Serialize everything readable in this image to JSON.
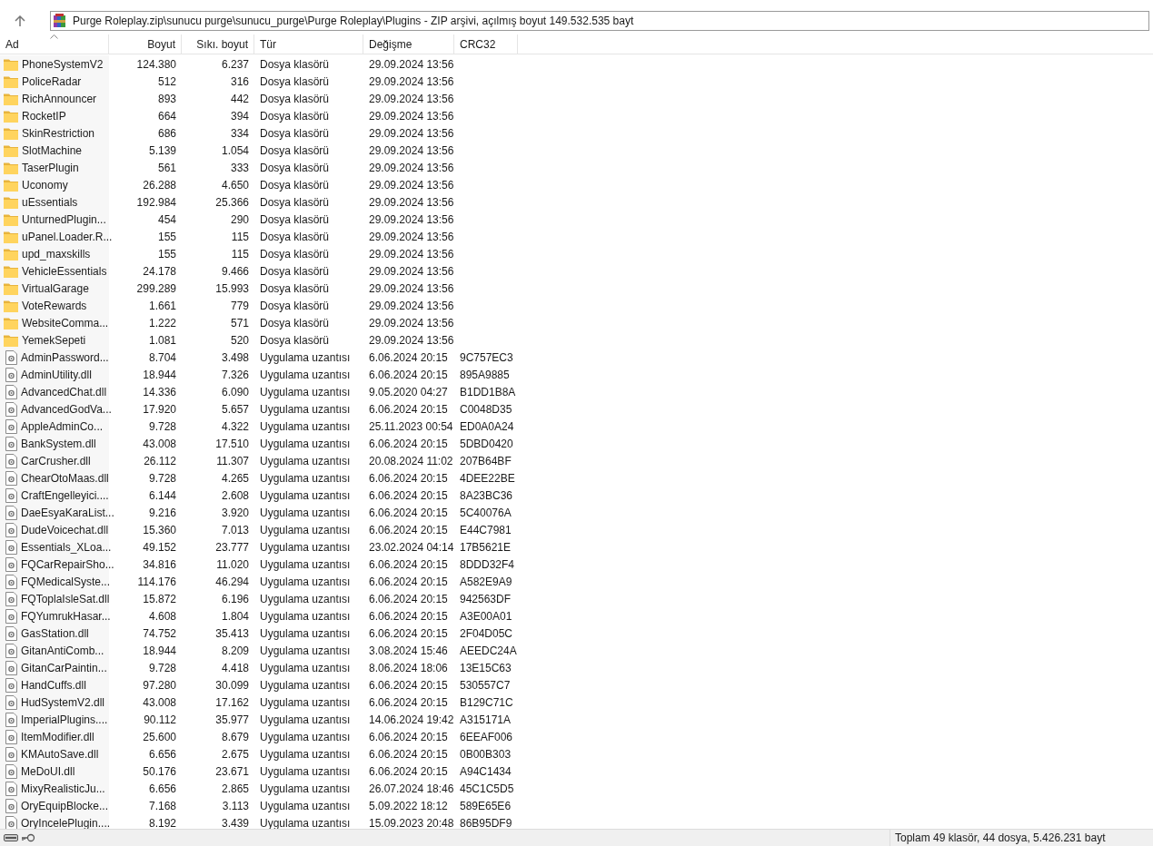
{
  "address": {
    "path": "Purge Roleplay.zip\\sunucu purge\\sunucu_purge\\Purge Roleplay\\Plugins - ZIP arşivi, açılmış boyut 149.532.535 bayt"
  },
  "columns": [
    {
      "label": "Ad",
      "sorted": true
    },
    {
      "label": "Boyut",
      "sorted": false
    },
    {
      "label": "Sıkı. boyut",
      "sorted": false
    },
    {
      "label": "Tür",
      "sorted": false
    },
    {
      "label": "Değişme",
      "sorted": false
    },
    {
      "label": "CRC32",
      "sorted": false
    }
  ],
  "rows": [
    {
      "kind": "folder",
      "name": "PhoneSystemV2",
      "size": "124.380",
      "packed": "6.237",
      "type": "Dosya klasörü",
      "modified": "29.09.2024 13:56"
    },
    {
      "kind": "folder",
      "name": "PoliceRadar",
      "size": "512",
      "packed": "316",
      "type": "Dosya klasörü",
      "modified": "29.09.2024 13:56"
    },
    {
      "kind": "folder",
      "name": "RichAnnouncer",
      "size": "893",
      "packed": "442",
      "type": "Dosya klasörü",
      "modified": "29.09.2024 13:56"
    },
    {
      "kind": "folder",
      "name": "RocketIP",
      "size": "664",
      "packed": "394",
      "type": "Dosya klasörü",
      "modified": "29.09.2024 13:56"
    },
    {
      "kind": "folder",
      "name": "SkinRestriction",
      "size": "686",
      "packed": "334",
      "type": "Dosya klasörü",
      "modified": "29.09.2024 13:56"
    },
    {
      "kind": "folder",
      "name": "SlotMachine",
      "size": "5.139",
      "packed": "1.054",
      "type": "Dosya klasörü",
      "modified": "29.09.2024 13:56"
    },
    {
      "kind": "folder",
      "name": "TaserPlugin",
      "size": "561",
      "packed": "333",
      "type": "Dosya klasörü",
      "modified": "29.09.2024 13:56"
    },
    {
      "kind": "folder",
      "name": "Uconomy",
      "size": "26.288",
      "packed": "4.650",
      "type": "Dosya klasörü",
      "modified": "29.09.2024 13:56"
    },
    {
      "kind": "folder",
      "name": "uEssentials",
      "size": "192.984",
      "packed": "25.366",
      "type": "Dosya klasörü",
      "modified": "29.09.2024 13:56"
    },
    {
      "kind": "folder",
      "name": "UnturnedPlugin...",
      "size": "454",
      "packed": "290",
      "type": "Dosya klasörü",
      "modified": "29.09.2024 13:56"
    },
    {
      "kind": "folder",
      "name": "uPanel.Loader.R...",
      "size": "155",
      "packed": "115",
      "type": "Dosya klasörü",
      "modified": "29.09.2024 13:56"
    },
    {
      "kind": "folder",
      "name": "upd_maxskills",
      "size": "155",
      "packed": "115",
      "type": "Dosya klasörü",
      "modified": "29.09.2024 13:56"
    },
    {
      "kind": "folder",
      "name": "VehicleEssentials",
      "size": "24.178",
      "packed": "9.466",
      "type": "Dosya klasörü",
      "modified": "29.09.2024 13:56"
    },
    {
      "kind": "folder",
      "name": "VirtualGarage",
      "size": "299.289",
      "packed": "15.993",
      "type": "Dosya klasörü",
      "modified": "29.09.2024 13:56"
    },
    {
      "kind": "folder",
      "name": "VoteRewards",
      "size": "1.661",
      "packed": "779",
      "type": "Dosya klasörü",
      "modified": "29.09.2024 13:56"
    },
    {
      "kind": "folder",
      "name": "WebsiteComma...",
      "size": "1.222",
      "packed": "571",
      "type": "Dosya klasörü",
      "modified": "29.09.2024 13:56"
    },
    {
      "kind": "folder",
      "name": "YemekSepeti",
      "size": "1.081",
      "packed": "520",
      "type": "Dosya klasörü",
      "modified": "29.09.2024 13:56"
    },
    {
      "kind": "file",
      "name": "AdminPassword...",
      "size": "8.704",
      "packed": "3.498",
      "type": "Uygulama uzantısı",
      "modified": "6.06.2024 20:15",
      "crc": "9C757EC3"
    },
    {
      "kind": "file",
      "name": "AdminUtility.dll",
      "size": "18.944",
      "packed": "7.326",
      "type": "Uygulama uzantısı",
      "modified": "6.06.2024 20:15",
      "crc": "895A9885"
    },
    {
      "kind": "file",
      "name": "AdvancedChat.dll",
      "size": "14.336",
      "packed": "6.090",
      "type": "Uygulama uzantısı",
      "modified": "9.05.2020 04:27",
      "crc": "B1DD1B8A"
    },
    {
      "kind": "file",
      "name": "AdvancedGodVa...",
      "size": "17.920",
      "packed": "5.657",
      "type": "Uygulama uzantısı",
      "modified": "6.06.2024 20:15",
      "crc": "C0048D35"
    },
    {
      "kind": "file",
      "name": "AppleAdminCo...",
      "size": "9.728",
      "packed": "4.322",
      "type": "Uygulama uzantısı",
      "modified": "25.11.2023 00:54",
      "crc": "ED0A0A24"
    },
    {
      "kind": "file",
      "name": "BankSystem.dll",
      "size": "43.008",
      "packed": "17.510",
      "type": "Uygulama uzantısı",
      "modified": "6.06.2024 20:15",
      "crc": "5DBD0420"
    },
    {
      "kind": "file",
      "name": "CarCrusher.dll",
      "size": "26.112",
      "packed": "11.307",
      "type": "Uygulama uzantısı",
      "modified": "20.08.2024 11:02",
      "crc": "207B64BF"
    },
    {
      "kind": "file",
      "name": "ChearOtoMaas.dll",
      "size": "9.728",
      "packed": "4.265",
      "type": "Uygulama uzantısı",
      "modified": "6.06.2024 20:15",
      "crc": "4DEE22BE"
    },
    {
      "kind": "file",
      "name": "CraftEngelleyici....",
      "size": "6.144",
      "packed": "2.608",
      "type": "Uygulama uzantısı",
      "modified": "6.06.2024 20:15",
      "crc": "8A23BC36"
    },
    {
      "kind": "file",
      "name": "DaeEsyaKaraList...",
      "size": "9.216",
      "packed": "3.920",
      "type": "Uygulama uzantısı",
      "modified": "6.06.2024 20:15",
      "crc": "5C40076A"
    },
    {
      "kind": "file",
      "name": "DudeVoicechat.dll",
      "size": "15.360",
      "packed": "7.013",
      "type": "Uygulama uzantısı",
      "modified": "6.06.2024 20:15",
      "crc": "E44C7981"
    },
    {
      "kind": "file",
      "name": "Essentials_XLoa...",
      "size": "49.152",
      "packed": "23.777",
      "type": "Uygulama uzantısı",
      "modified": "23.02.2024 04:14",
      "crc": "17B5621E"
    },
    {
      "kind": "file",
      "name": "FQCarRepairSho...",
      "size": "34.816",
      "packed": "11.020",
      "type": "Uygulama uzantısı",
      "modified": "6.06.2024 20:15",
      "crc": "8DDD32F4"
    },
    {
      "kind": "file",
      "name": "FQMedicalSyste...",
      "size": "114.176",
      "packed": "46.294",
      "type": "Uygulama uzantısı",
      "modified": "6.06.2024 20:15",
      "crc": "A582E9A9"
    },
    {
      "kind": "file",
      "name": "FQToplaIsleSat.dll",
      "size": "15.872",
      "packed": "6.196",
      "type": "Uygulama uzantısı",
      "modified": "6.06.2024 20:15",
      "crc": "942563DF"
    },
    {
      "kind": "file",
      "name": "FQYumrukHasar...",
      "size": "4.608",
      "packed": "1.804",
      "type": "Uygulama uzantısı",
      "modified": "6.06.2024 20:15",
      "crc": "A3E00A01"
    },
    {
      "kind": "file",
      "name": "GasStation.dll",
      "size": "74.752",
      "packed": "35.413",
      "type": "Uygulama uzantısı",
      "modified": "6.06.2024 20:15",
      "crc": "2F04D05C"
    },
    {
      "kind": "file",
      "name": "GitanAntiComb...",
      "size": "18.944",
      "packed": "8.209",
      "type": "Uygulama uzantısı",
      "modified": "3.08.2024 15:46",
      "crc": "AEEDC24A"
    },
    {
      "kind": "file",
      "name": "GitanCarPaintin...",
      "size": "9.728",
      "packed": "4.418",
      "type": "Uygulama uzantısı",
      "modified": "8.06.2024 18:06",
      "crc": "13E15C63"
    },
    {
      "kind": "file",
      "name": "HandCuffs.dll",
      "size": "97.280",
      "packed": "30.099",
      "type": "Uygulama uzantısı",
      "modified": "6.06.2024 20:15",
      "crc": "530557C7"
    },
    {
      "kind": "file",
      "name": "HudSystemV2.dll",
      "size": "43.008",
      "packed": "17.162",
      "type": "Uygulama uzantısı",
      "modified": "6.06.2024 20:15",
      "crc": "B129C71C"
    },
    {
      "kind": "file",
      "name": "ImperialPlugins....",
      "size": "90.112",
      "packed": "35.977",
      "type": "Uygulama uzantısı",
      "modified": "14.06.2024 19:42",
      "crc": "A315171A"
    },
    {
      "kind": "file",
      "name": "ItemModifier.dll",
      "size": "25.600",
      "packed": "8.679",
      "type": "Uygulama uzantısı",
      "modified": "6.06.2024 20:15",
      "crc": "6EEAF006"
    },
    {
      "kind": "file",
      "name": "KMAutoSave.dll",
      "size": "6.656",
      "packed": "2.675",
      "type": "Uygulama uzantısı",
      "modified": "6.06.2024 20:15",
      "crc": "0B00B303"
    },
    {
      "kind": "file",
      "name": "MeDoUI.dll",
      "size": "50.176",
      "packed": "23.671",
      "type": "Uygulama uzantısı",
      "modified": "6.06.2024 20:15",
      "crc": "A94C1434"
    },
    {
      "kind": "file",
      "name": "MixyRealisticJu...",
      "size": "6.656",
      "packed": "2.865",
      "type": "Uygulama uzantısı",
      "modified": "26.07.2024 18:46",
      "crc": "45C1C5D5"
    },
    {
      "kind": "file",
      "name": "OryEquipBlocke...",
      "size": "7.168",
      "packed": "3.113",
      "type": "Uygulama uzantısı",
      "modified": "5.09.2022 18:12",
      "crc": "589E65E6"
    },
    {
      "kind": "file",
      "name": "OryIncelePlugin....",
      "size": "8.192",
      "packed": "3.439",
      "type": "Uygulama uzantısı",
      "modified": "15.09.2023 20:48",
      "crc": "86B95DF9"
    }
  ],
  "status_bar": {
    "text": "Toplam 49 klasör, 44 dosya, 5.426.231 bayt"
  }
}
